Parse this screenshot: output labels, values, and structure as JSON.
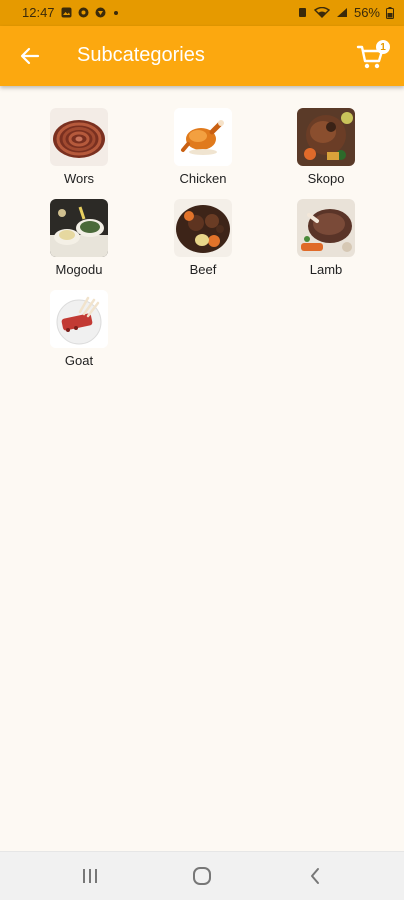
{
  "status_bar": {
    "time": "12:47",
    "battery": "56%"
  },
  "app_bar": {
    "title": "Subcategories",
    "cart_count": "1"
  },
  "subcategories": [
    {
      "label": "Wors",
      "icon": "wors-image"
    },
    {
      "label": "Chicken",
      "icon": "chicken-image"
    },
    {
      "label": "Skopo",
      "icon": "skopo-image"
    },
    {
      "label": "Mogodu",
      "icon": "mogodu-image"
    },
    {
      "label": "Beef",
      "icon": "beef-image"
    },
    {
      "label": "Lamb",
      "icon": "lamb-image"
    },
    {
      "label": "Goat",
      "icon": "goat-image"
    }
  ],
  "colors": {
    "app_bar": "#fca80f",
    "status_bar": "#e69a00",
    "background": "#fdf9f3"
  }
}
